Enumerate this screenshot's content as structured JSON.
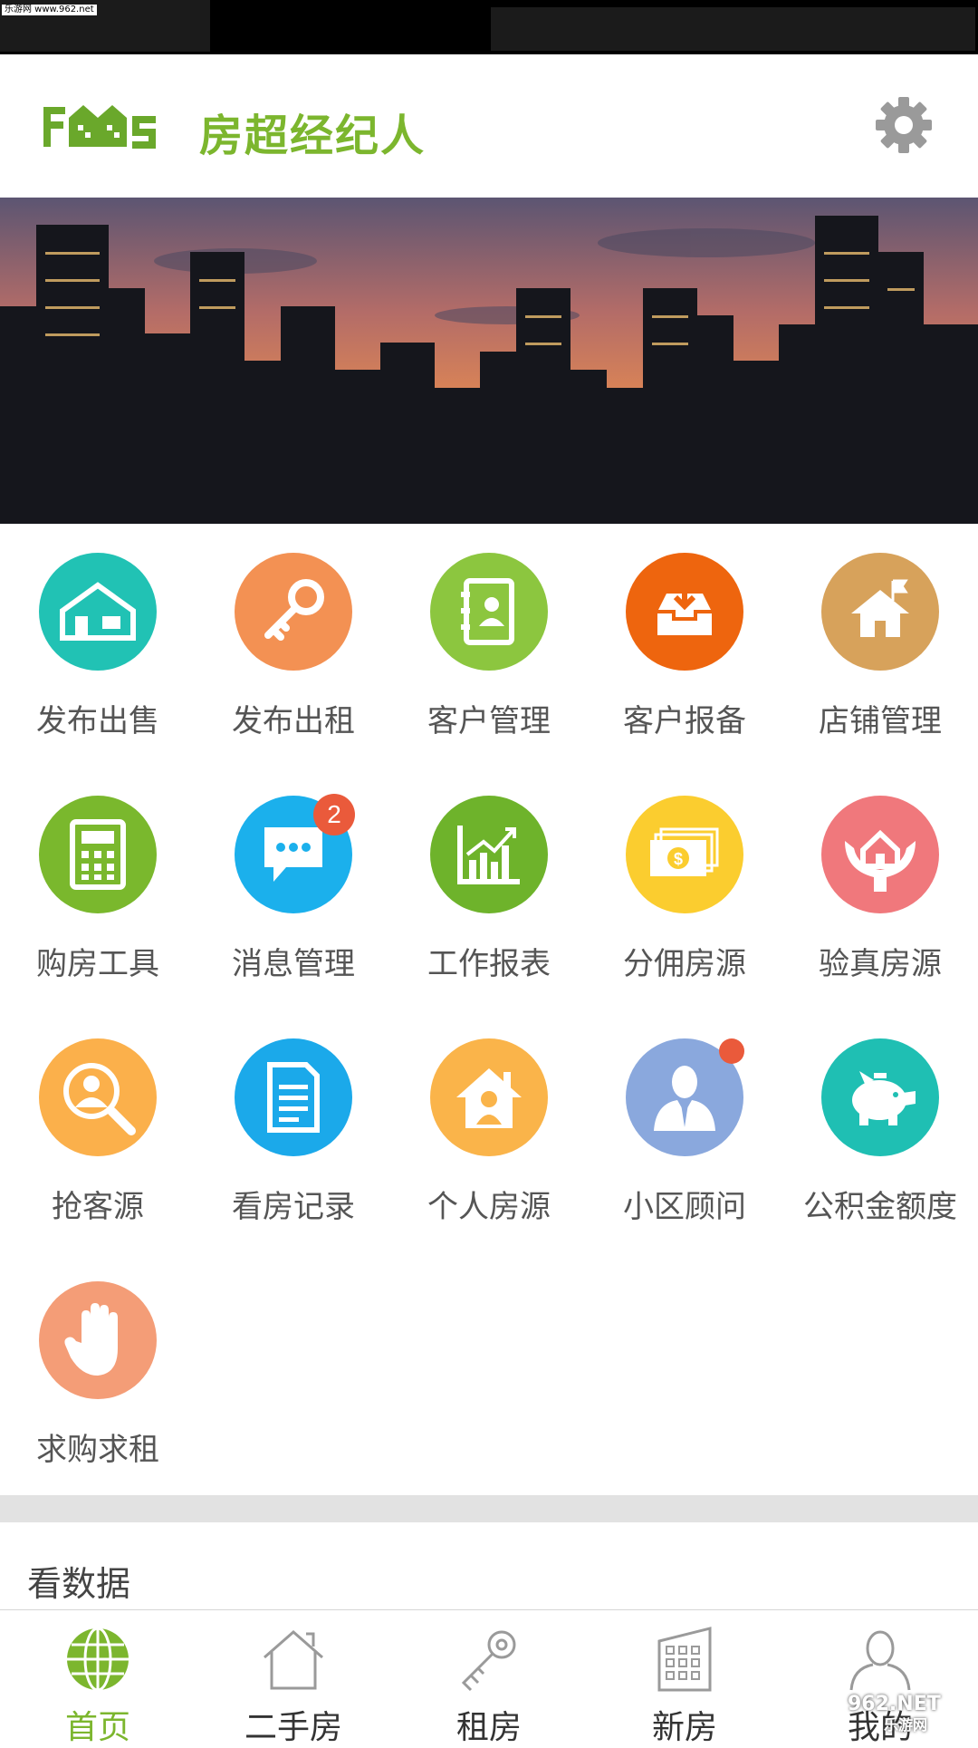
{
  "status_bar": {
    "watermark": "乐游网 www.962.net"
  },
  "header": {
    "brand": "房超经纪人",
    "settings_icon": "gear-icon"
  },
  "banner": {
    "image": "city-skyline-at-dusk"
  },
  "grid": {
    "items": [
      {
        "label": "发布出售",
        "icon": "house-icon",
        "color": "#21c2b4"
      },
      {
        "label": "发布出租",
        "icon": "key-icon",
        "color": "#f39153"
      },
      {
        "label": "客户管理",
        "icon": "contacts-book-icon",
        "color": "#8cc63f"
      },
      {
        "label": "客户报备",
        "icon": "inbox-download-icon",
        "color": "#ee650e"
      },
      {
        "label": "店铺管理",
        "icon": "house-flag-icon",
        "color": "#d7a25b"
      },
      {
        "label": "购房工具",
        "icon": "calculator-icon",
        "color": "#7ab82d"
      },
      {
        "label": "消息管理",
        "icon": "chat-bubble-icon",
        "color": "#1bb0ec",
        "badge": "2"
      },
      {
        "label": "工作报表",
        "icon": "chart-icon",
        "color": "#6eb32b"
      },
      {
        "label": "分佣房源",
        "icon": "money-icon",
        "color": "#fbcd2f"
      },
      {
        "label": "验真房源",
        "icon": "hands-house-icon",
        "color": "#f0787c"
      },
      {
        "label": "抢客源",
        "icon": "search-person-icon",
        "color": "#fbb04b"
      },
      {
        "label": "看房记录",
        "icon": "document-icon",
        "color": "#1ba9ea"
      },
      {
        "label": "个人房源",
        "icon": "house-person-icon",
        "color": "#fab44a"
      },
      {
        "label": "小区顾问",
        "icon": "advisor-icon",
        "color": "#8aa8dd",
        "dot": true
      },
      {
        "label": "公积金额度",
        "icon": "piggy-bank-icon",
        "color": "#1fbfb3"
      },
      {
        "label": "求购求租",
        "icon": "hand-icon",
        "color": "#f49d77"
      }
    ]
  },
  "data_section": {
    "title": "看数据"
  },
  "tabbar": {
    "tabs": [
      {
        "label": "首页",
        "icon": "globe-icon",
        "active": true
      },
      {
        "label": "二手房",
        "icon": "house-outline-icon"
      },
      {
        "label": "租房",
        "icon": "key-outline-icon"
      },
      {
        "label": "新房",
        "icon": "building-icon"
      },
      {
        "label": "我的",
        "icon": "user-icon"
      }
    ]
  },
  "watermark_bottom": {
    "text": "962.NET",
    "subtext": "乐游网"
  }
}
